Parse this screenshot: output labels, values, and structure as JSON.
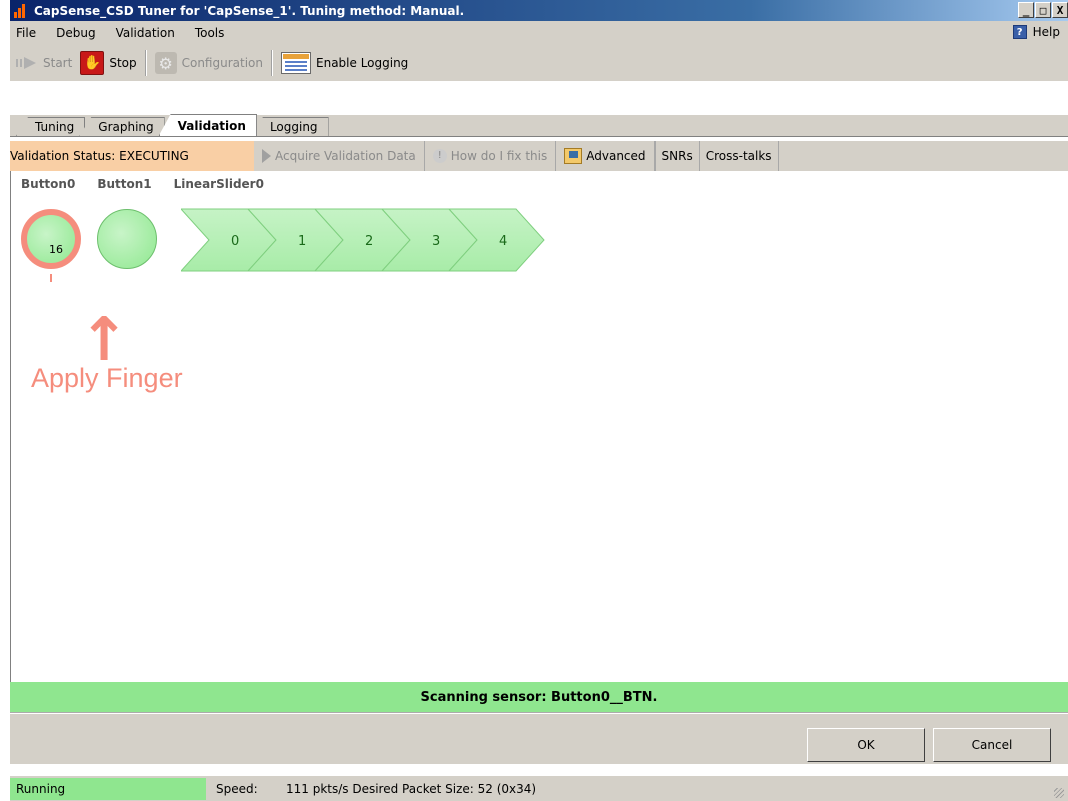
{
  "window": {
    "title": "CapSense_CSD Tuner for 'CapSense_1'. Tuning method: Manual.",
    "controls": [
      "_",
      "□",
      "X"
    ]
  },
  "menu": {
    "items": [
      {
        "label": "File",
        "accel": "F"
      },
      {
        "label": "Debug",
        "accel": "D"
      },
      {
        "label": "Validation",
        "accel": "V"
      },
      {
        "label": "Tools",
        "accel": "T"
      }
    ],
    "help": "Help"
  },
  "toolbar": {
    "start": "Start",
    "stop": "Stop",
    "configuration": "Configuration",
    "enable_logging": "Enable Logging"
  },
  "tabs": [
    "Tuning",
    "Graphing",
    "Validation",
    "Logging"
  ],
  "active_tab": "Validation",
  "validation_bar": {
    "status": "Validation Status:  EXECUTING",
    "acquire": "Acquire Validation Data",
    "how_fix": "How do I fix this",
    "advanced": "Advanced",
    "snrs": "SNRs",
    "crosstalks": "Cross-talks"
  },
  "sensors": {
    "labels": [
      "Button0",
      "Button1",
      "LinearSlider0"
    ],
    "button0_value": "16",
    "slider_segments": [
      "0",
      "1",
      "2",
      "3",
      "4"
    ]
  },
  "instruction": "Apply Finger",
  "scan_message": "Scanning sensor: Button0__BTN.",
  "dialog": {
    "ok": "OK",
    "cancel": "Cancel"
  },
  "statusbar": {
    "state": "Running",
    "speed_label": "Speed:",
    "speed_value": "111 pkts/s  Desired Packet Size:  52 (0x34)"
  },
  "colors": {
    "title_gradient": "#0a246a",
    "active_green": "#8fe68f",
    "status_orange": "#f9cfa5",
    "finger_coral": "#f58d7d"
  }
}
